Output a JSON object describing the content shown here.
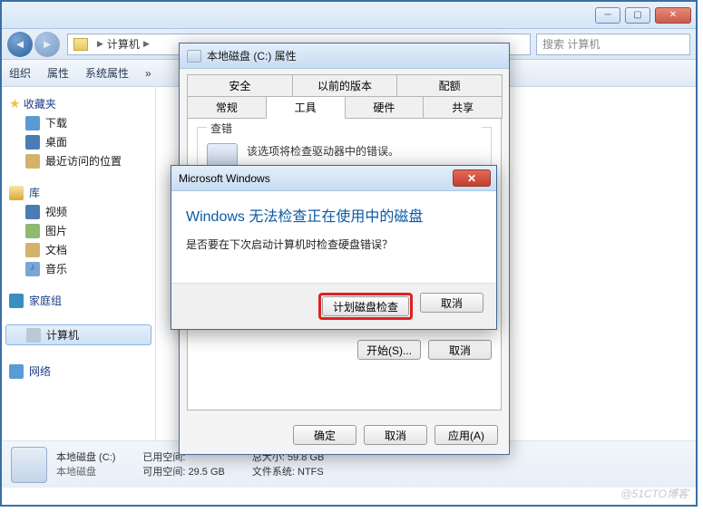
{
  "window": {
    "breadcrumb_root": "计算机",
    "search_placeholder": "搜索 计算机"
  },
  "toolbar": {
    "org": "组织",
    "prop": "属性",
    "sys": "系统属性",
    "more": "»"
  },
  "sidebar": {
    "fav": "收藏夹",
    "fav_items": [
      "下载",
      "桌面",
      "最近访问的位置"
    ],
    "lib": "库",
    "lib_items": [
      "视频",
      "图片",
      "文档",
      "音乐"
    ],
    "homegroup": "家庭组",
    "computer": "计算机",
    "network": "网络"
  },
  "status": {
    "drive_name": "本地磁盘 (C:)",
    "drive_type": "本地磁盘",
    "used_label": "已用空间:",
    "free_label": "可用空间:",
    "free_value": "29.5 GB",
    "total_label": "总大小:",
    "total_value": "59.8 GB",
    "fs_label": "文件系统:",
    "fs_value": "NTFS"
  },
  "props": {
    "title": "本地磁盘 (C:) 属性",
    "tabs_row1": [
      "安全",
      "以前的版本",
      "配额"
    ],
    "tabs_row2": [
      "常规",
      "工具",
      "硬件",
      "共享"
    ],
    "active_tab": "工具",
    "chkdsk_legend": "查错",
    "chkdsk_text": "该选项将检查驱动器中的错误。",
    "start_btn": "开始(S)...",
    "cancel_btn": "取消",
    "ok": "确定",
    "cancel": "取消",
    "apply": "应用(A)"
  },
  "modal": {
    "title": "Microsoft Windows",
    "heading": "Windows 无法检查正在使用中的磁盘",
    "body": "是否要在下次启动计算机时检查硬盘错误？",
    "schedule": "计划磁盘检查",
    "cancel": "取消"
  },
  "watermark": "@51CTO博客"
}
